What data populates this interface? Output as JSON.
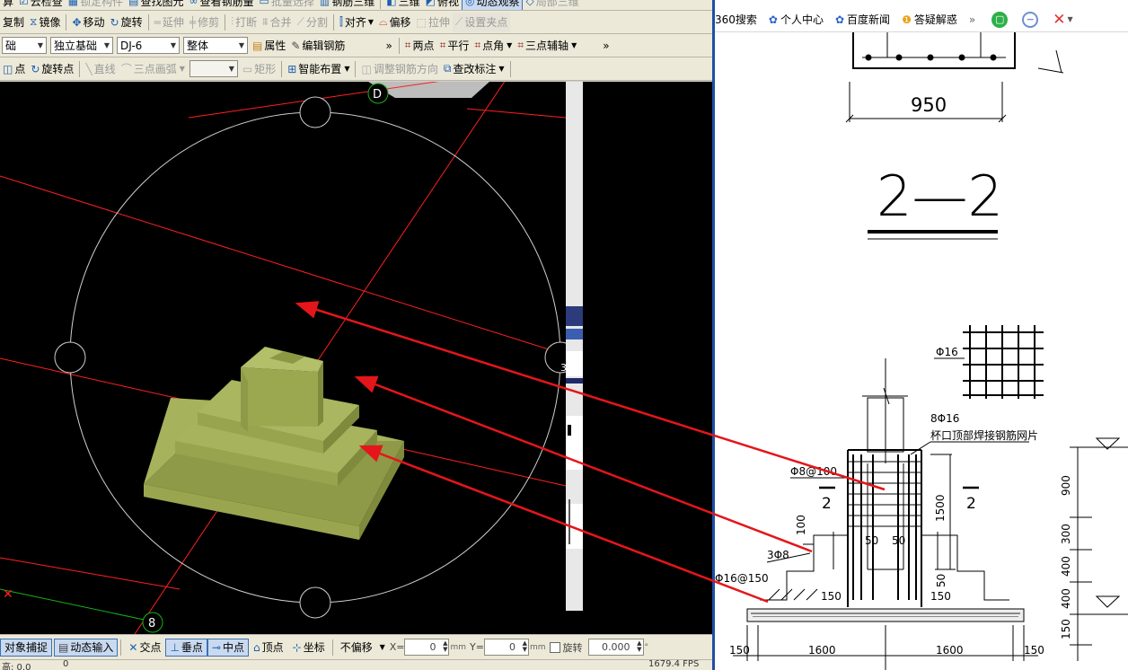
{
  "toolbar1": {
    "items": [
      {
        "label": "算",
        "icon": "calc-icon",
        "enabled": true
      },
      {
        "label": "云检查",
        "icon": "cloud-check-icon",
        "enabled": true
      },
      {
        "label": "锁定构件",
        "icon": "lock-icon",
        "enabled": false
      },
      {
        "label": "查找图元",
        "icon": "find-icon",
        "enabled": true
      },
      {
        "label": "查看钢筋量",
        "icon": "view-rebar-icon",
        "enabled": true
      },
      {
        "label": "批量选择",
        "icon": "batch-select-icon",
        "enabled": false
      },
      {
        "label": "钢筋三维",
        "icon": "rebar-3d-icon",
        "enabled": true
      },
      {
        "label": "三维",
        "icon": "3d-icon",
        "enabled": true
      },
      {
        "label": "俯视",
        "icon": "top-view-icon",
        "enabled": true
      },
      {
        "label": "动态观察",
        "icon": "orbit-icon",
        "enabled": true
      },
      {
        "label": "局部三维",
        "icon": "local-3d-icon",
        "enabled": false
      }
    ]
  },
  "toolbar2": {
    "items": [
      {
        "label": "复制",
        "icon": "copy-icon",
        "enabled": true
      },
      {
        "label": "镜像",
        "icon": "mirror-icon",
        "enabled": true
      },
      {
        "label": "移动",
        "icon": "move-icon",
        "enabled": true
      },
      {
        "label": "旋转",
        "icon": "rotate-icon",
        "enabled": true
      },
      {
        "label": "延伸",
        "icon": "extend-icon",
        "enabled": false
      },
      {
        "label": "修剪",
        "icon": "trim-icon",
        "enabled": false
      },
      {
        "label": "打断",
        "icon": "break-icon",
        "enabled": false
      },
      {
        "label": "合并",
        "icon": "merge-icon",
        "enabled": false
      },
      {
        "label": "分割",
        "icon": "split-icon",
        "enabled": false
      },
      {
        "label": "对齐",
        "icon": "align-icon",
        "enabled": true,
        "dropdown": true
      },
      {
        "label": "偏移",
        "icon": "offset-icon",
        "enabled": true
      },
      {
        "label": "拉伸",
        "icon": "stretch-icon",
        "enabled": false
      },
      {
        "label": "设置夹点",
        "icon": "grip-icon",
        "enabled": false
      }
    ]
  },
  "toolbar3": {
    "floor_combo": "础",
    "type_combo": "独立基础",
    "element_combo": "DJ-6",
    "whole_combo": "整体",
    "properties": "属性",
    "edit_rebar": "编辑钢筋",
    "more": "»",
    "axis_items": [
      "两点",
      "平行",
      "点角",
      "三点辅轴"
    ]
  },
  "toolbar4": {
    "items": [
      {
        "label": "点",
        "icon": "point-icon",
        "enabled": true
      },
      {
        "label": "旋转点",
        "icon": "rotate-point-icon",
        "enabled": true
      },
      {
        "label": "直线",
        "icon": "line-icon",
        "enabled": false
      },
      {
        "label": "三点画弧",
        "icon": "arc-icon",
        "enabled": false
      },
      {
        "label": "矩形",
        "icon": "rect-icon",
        "enabled": false
      },
      {
        "label": "智能布置",
        "icon": "smart-layout-icon",
        "enabled": true
      },
      {
        "label": "调整钢筋方向",
        "icon": "rebar-dir-icon",
        "enabled": false
      },
      {
        "label": "查改标注",
        "icon": "annotation-icon",
        "enabled": true
      }
    ]
  },
  "viewport": {
    "axis_label_top": "D",
    "axis_label_bottom": "8",
    "orbit_marker_right": "3",
    "colors": {
      "background": "#000000",
      "footing": "#a2ae5a",
      "axis": "#ff2020",
      "orbit": "#d0d0d0"
    }
  },
  "snapbar": {
    "object_snap": "对象捕捉",
    "dynamic_input": "动态输入",
    "snaps": [
      {
        "label": "交点",
        "icon": "intersection-icon",
        "active": false
      },
      {
        "label": "垂点",
        "icon": "perpendicular-icon",
        "active": true
      },
      {
        "label": "中点",
        "icon": "midpoint-icon",
        "active": true
      },
      {
        "label": "顶点",
        "icon": "vertex-icon",
        "active": false
      },
      {
        "label": "坐标",
        "icon": "coordinate-icon",
        "active": false
      }
    ],
    "offset_mode": "不偏移",
    "x_label": "X=",
    "x_value": "0",
    "y_label": "Y=",
    "y_value": "0",
    "unit": "mm",
    "rotate_label": "旋转",
    "rotate_value": "0.000",
    "degree": "°"
  },
  "statusbar": {
    "left": "高: 0.0",
    "mid": "0",
    "right": "1679.4 FPS"
  },
  "browser": {
    "items": [
      {
        "label": "360搜索",
        "icon": ""
      },
      {
        "label": "个人中心",
        "icon": "paw-icon"
      },
      {
        "label": "百度新闻",
        "icon": "paw-icon"
      },
      {
        "label": "答疑解惑",
        "icon": "bulb-icon"
      }
    ],
    "more": "»"
  },
  "drawing": {
    "top_dim": "950",
    "section_title": "2—2",
    "mesh_bar": "Φ16",
    "cup_label_count": "8Φ16",
    "cup_label_text": "杯口顶部焊接钢筋网片",
    "stirrup": "Φ8@100",
    "section_mark": "2",
    "dim_100": "100",
    "bars_3": "3Φ8",
    "bottom_bar": "Φ16@150",
    "dim_50_a": "50",
    "dim_50_b": "50",
    "dim_1500": "1500",
    "dim_50_c": "50",
    "dim_150_left": "150",
    "dim_150_right": "150",
    "right_dims": [
      "900",
      "300",
      "400",
      "400",
      "150"
    ],
    "bottom_dims": [
      "150",
      "1600",
      "1600",
      "150"
    ]
  }
}
